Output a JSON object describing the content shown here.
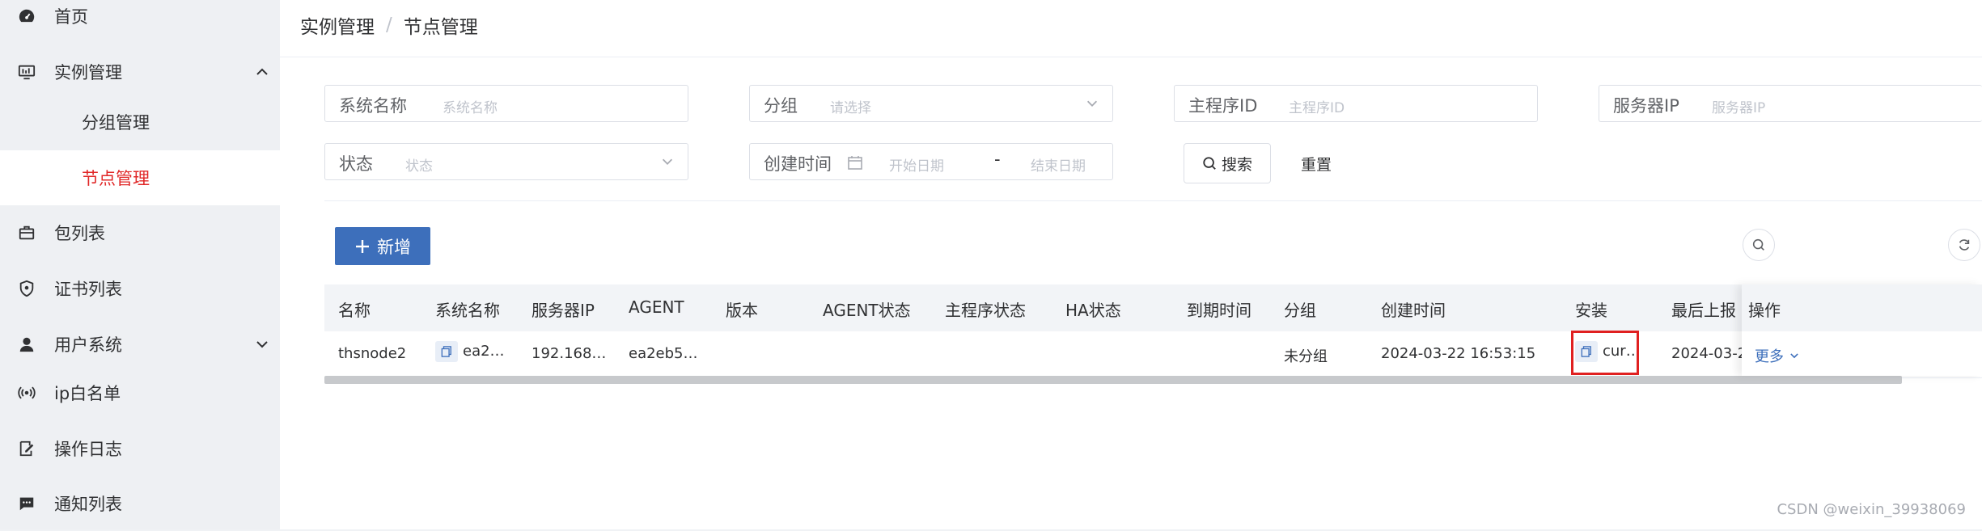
{
  "sidebar": {
    "items": [
      {
        "label": "首页",
        "icon": "dashboard-icon"
      },
      {
        "label": "实例管理",
        "icon": "monitor-icon"
      },
      {
        "label": "分组管理"
      },
      {
        "label": "节点管理"
      },
      {
        "label": "包列表",
        "icon": "briefcase-icon"
      },
      {
        "label": "证书列表",
        "icon": "shield-icon"
      },
      {
        "label": "用户系统",
        "icon": "user-icon"
      },
      {
        "label": "ip白名单",
        "icon": "broadcast-icon"
      },
      {
        "label": "操作日志",
        "icon": "edit-log-icon"
      },
      {
        "label": "通知列表",
        "icon": "chat-icon"
      }
    ]
  },
  "breadcrumb": {
    "parent": "实例管理",
    "separator": "/",
    "current": "节点管理"
  },
  "filters": {
    "system_name": {
      "label": "系统名称",
      "placeholder": "系统名称"
    },
    "group": {
      "label": "分组",
      "placeholder": "请选择"
    },
    "main_program_id": {
      "label": "主程序ID",
      "placeholder": "主程序ID"
    },
    "server_ip": {
      "label": "服务器IP",
      "placeholder": "服务器IP"
    },
    "status": {
      "label": "状态",
      "placeholder": "状态"
    },
    "created_time": {
      "label": "创建时间",
      "start_placeholder": "开始日期",
      "range_sep": "-",
      "end_placeholder": "结束日期"
    }
  },
  "actions": {
    "search_label": "搜索",
    "reset_label": "重置",
    "add_label": "新增"
  },
  "table": {
    "columns": [
      "名称",
      "系统名称",
      "服务器IP",
      "AGENT",
      "版本",
      "AGENT状态",
      "主程序状态",
      "HA状态",
      "到期时间",
      "分组",
      "创建时间",
      "安装",
      "最后上报",
      "操作"
    ],
    "rows": [
      {
        "name": "thsnode2",
        "system_name": "ea2…",
        "server_ip": "192.168…",
        "agent": "ea2eb5…",
        "version": "",
        "agent_status": "",
        "main_status": "",
        "ha_status": "",
        "expire_time": "",
        "group": "未分组",
        "created_time": "2024-03-22 16:53:15",
        "install": "cur…",
        "last_report": "2024-03-2",
        "op_more": "更多"
      }
    ]
  },
  "watermark": "CSDN @weixin_39938069",
  "colors": {
    "accent": "#3d6fbb",
    "active_menu": "#e02727",
    "highlight": "#e02020"
  }
}
